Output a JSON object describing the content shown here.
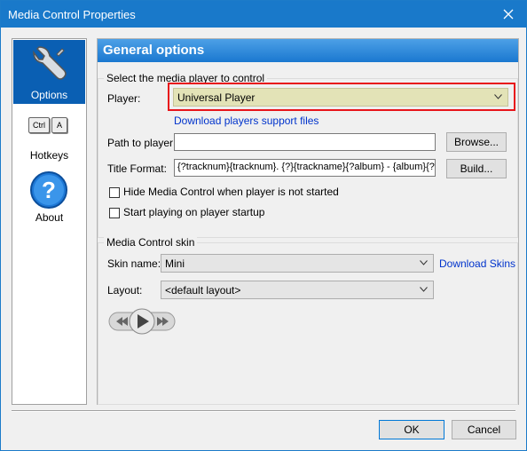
{
  "window": {
    "title": "Media Control Properties"
  },
  "sidebar": {
    "items": [
      {
        "label": "Options"
      },
      {
        "label": "Hotkeys",
        "keys": [
          "Ctrl",
          "A"
        ]
      },
      {
        "label": "About"
      }
    ]
  },
  "panel": {
    "header": "General options",
    "player_group": {
      "title": "Select the media player to control",
      "player_label": "Player:",
      "player_value": "Universal Player",
      "download_link": "Download players support files",
      "path_label": "Path to player:",
      "path_value": "",
      "browse_button": "Browse...",
      "format_label": "Title Format:",
      "format_value": "{?tracknum}{tracknum}. {?}{trackname}{?album} - {album}{?}",
      "build_button": "Build...",
      "hide_checkbox": "Hide Media Control when player is not started",
      "start_checkbox": "Start playing on player startup"
    },
    "skin_group": {
      "title": "Media Control skin",
      "skin_label": "Skin name:",
      "skin_value": "Mini",
      "download_skins": "Download Skins",
      "layout_label": "Layout:",
      "layout_value": "<default layout>"
    }
  },
  "footer": {
    "ok": "OK",
    "cancel": "Cancel"
  },
  "colors": {
    "accent": "#1979ca",
    "highlight_border": "#e8141a",
    "player_bg": "#e3e3b7"
  }
}
